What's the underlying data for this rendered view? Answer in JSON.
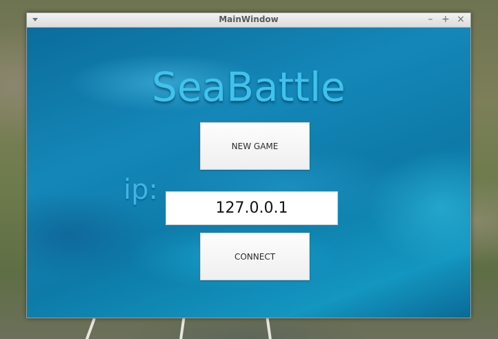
{
  "window": {
    "title": "MainWindow",
    "minimize_glyph": "–",
    "maximize_glyph": "+",
    "close_glyph": "×"
  },
  "app": {
    "title": "SeaBattle",
    "new_game_label": "NEW GAME",
    "ip_label": "ip:",
    "ip_value": "127.0.0.1",
    "connect_label": "CONNECT"
  },
  "colors": {
    "title_accent": "#3fc3ec",
    "water_base": "#0b6f9a"
  },
  "icons": {
    "window_menu": "chevron-down-icon",
    "minimize": "minimize-icon",
    "maximize": "maximize-icon",
    "close": "close-icon"
  }
}
